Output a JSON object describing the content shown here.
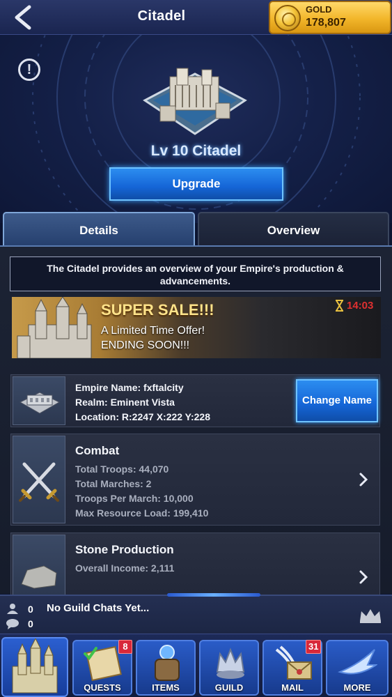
{
  "header": {
    "title": "Citadel",
    "gold_label": "GOLD",
    "gold_value": "178,807"
  },
  "building": {
    "level_label": "Lv 10 Citadel",
    "upgrade_label": "Upgrade"
  },
  "tabs": [
    {
      "label": "Details",
      "active": true
    },
    {
      "label": "Overview",
      "active": false
    }
  ],
  "description": "The Citadel provides an overview of your Empire's production & advancements.",
  "sale": {
    "title": "SUPER SALE!!!",
    "line1": "A Limited Time Offer!",
    "line2": "ENDING SOON!!!",
    "timer": "14:03",
    "timer_color": "#e03030"
  },
  "empire": {
    "name_line": "Empire Name: fxftalcity",
    "realm_line": "Realm: Eminent Vista",
    "location_line": "Location: R:2247 X:222 Y:228",
    "change_name_label": "Change Name"
  },
  "combat": {
    "title": "Combat",
    "stats": [
      "Total Troops: 44,070",
      "Total Marches: 2",
      "Troops Per March: 10,000",
      "Max Resource Load: 199,410"
    ]
  },
  "stone": {
    "title": "Stone Production",
    "stats": [
      "Overall Income: 2,111"
    ]
  },
  "chat": {
    "friend_count": "0",
    "chat_count": "0",
    "message": "No Guild Chats Yet..."
  },
  "nav": {
    "items": [
      {
        "label": "QUESTS",
        "badge": "8",
        "icon": "quest-scroll-icon"
      },
      {
        "label": "ITEMS",
        "badge": "",
        "icon": "backpack-icon"
      },
      {
        "label": "GUILD",
        "badge": "",
        "icon": "guild-crest-icon"
      },
      {
        "label": "MAIL",
        "badge": "31",
        "icon": "mail-icon"
      },
      {
        "label": "MORE",
        "badge": "",
        "icon": "more-arrow-icon"
      }
    ]
  },
  "colors": {
    "accent_blue": "#1565d6",
    "gold": "#f2b62a",
    "badge_red": "#d8283a"
  }
}
